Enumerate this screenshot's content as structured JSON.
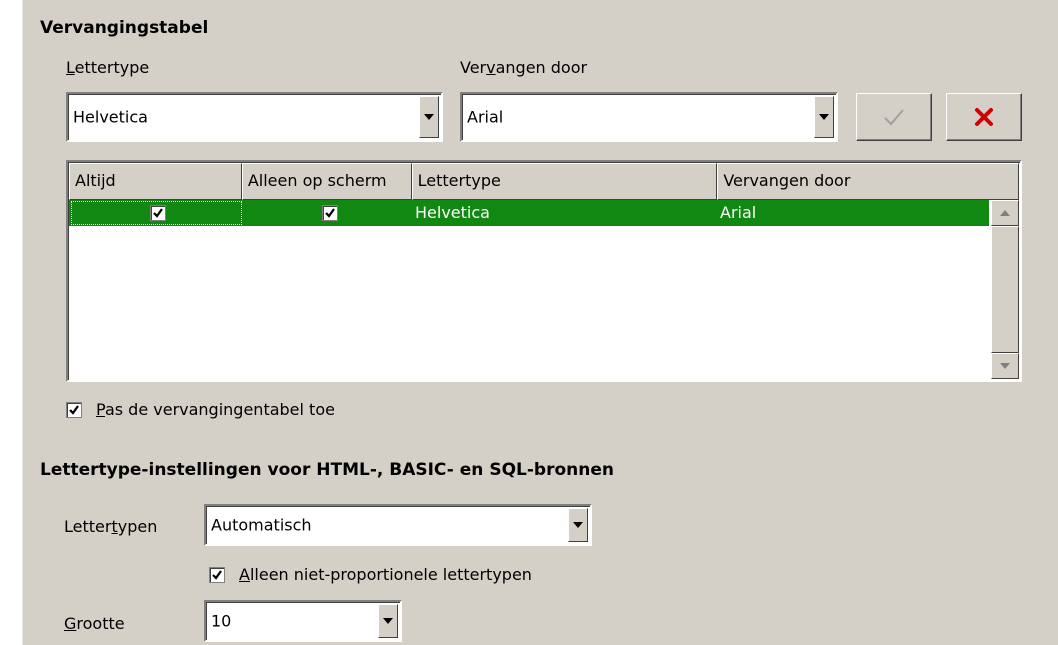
{
  "replacement": {
    "title": "Vervangingstabel",
    "font_label": "Lettertype",
    "replace_label": "Vervangen door",
    "font_value": "Helvetica",
    "replace_value": "Arial",
    "apply_icon": "checkmark-icon",
    "delete_icon": "delete-x-icon",
    "columns": [
      "Altijd",
      "Alleen op scherm",
      "Lettertype",
      "Vervangen door"
    ],
    "rows": [
      {
        "always": true,
        "screen_only": true,
        "font": "Helvetica",
        "replace": "Arial"
      }
    ],
    "selected_row_color": "#118811",
    "apply_table_label": "Pas de vervangingentabel toe",
    "apply_table_checked": true
  },
  "source": {
    "title": "Lettertype-instellingen voor HTML-, BASIC- en SQL-bronnen",
    "fonts_label": "Lettertypen",
    "fonts_value": "Automatisch",
    "nonprop_label": "Alleen niet-proportionele lettertypen",
    "nonprop_checked": true,
    "size_label": "Grootte",
    "size_value": "10"
  }
}
